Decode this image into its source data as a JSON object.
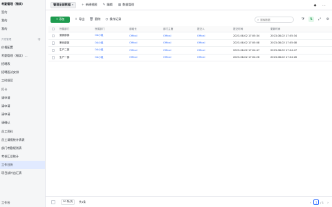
{
  "sidebar": {
    "top": [
      "考勤管理（微笑）",
      "…"
    ],
    "items": [
      "签约",
      "我的",
      "我的"
    ],
    "section_label": "开发管理",
    "items2": [
      "价格配置",
      "考勤管理（微笑）…",
      "招聘表",
      "招聘面试安排",
      "工时规范",
      "打卡",
      "请申请",
      "请申请",
      "请申请",
      "请确认",
      "员工资料",
      "员工请假统计表表",
      "部门考勤规则表",
      "考核汇总统计",
      "工作日历",
      "项目部外出汇表"
    ],
    "active_index": 14,
    "bottom": "工作台"
  },
  "topbar": {
    "view_tab": "管理全部数据",
    "actions": [
      {
        "icon": "plus-icon",
        "label": "新建视图"
      },
      {
        "icon": "edit-icon",
        "label": "编辑"
      },
      {
        "icon": "table-icon",
        "label": "数据管理"
      }
    ]
  },
  "toolbar": {
    "add_label": "+ 添加",
    "tools": [
      {
        "icon": "export-icon",
        "label": "导出"
      },
      {
        "icon": "delete-icon",
        "label": "删除"
      },
      {
        "icon": "log-icon",
        "label": "操作记录"
      }
    ],
    "search_placeholder": "搜索数据"
  },
  "table": {
    "columns": [
      "所属部门",
      "所属部门",
      "部组长",
      "部门主管",
      "提交人",
      "提交时间",
      "更新时间"
    ],
    "rows": [
      [
        "营销部部",
        "OA小组",
        "Offical",
        "Offical",
        "Offical",
        "2023-08-02 17:05:34",
        "2023-08-02 17:05:34"
      ],
      [
        "策划部部",
        "OA小组",
        "Offical",
        "Offical",
        "Offical",
        "2023-08-02 17:05:08",
        "2023-08-02 17:05:08"
      ],
      [
        "生产二部",
        "OA小组",
        "Offical",
        "Offical",
        "Offical",
        "2023-08-02 17:04:47",
        "2023-08-02 17:04:47"
      ],
      [
        "生产一部",
        "OA小组",
        "Offical",
        "Offical",
        "Offical",
        "2023-08-02 17:04:26",
        "2023-08-02 17:04:26"
      ]
    ]
  },
  "footer": {
    "page_size": "20 条/页",
    "total": "共4条",
    "current_page": "1",
    "page_total": "/ 1"
  }
}
